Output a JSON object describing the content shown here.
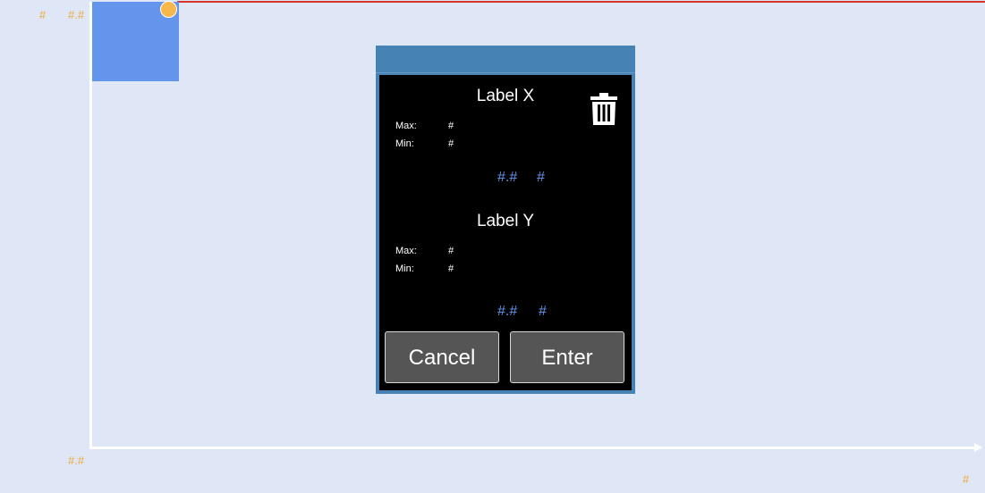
{
  "plot": {
    "top_left_label": "#",
    "y_max_label": "#.#",
    "y_min_label": "#.#",
    "x_max_label": "#"
  },
  "dialog": {
    "x_section": {
      "title": "Label X",
      "max_label": "Max:",
      "max_value": "#",
      "min_label": "Min:",
      "min_value": "#",
      "value": "#.#",
      "unit": "#"
    },
    "y_section": {
      "title": "Label Y",
      "max_label": "Max:",
      "max_value": "#",
      "min_label": "Min:",
      "min_value": "#",
      "value": "#.#",
      "unit": "#"
    },
    "delete_icon": "trash-icon",
    "cancel_label": "Cancel",
    "enter_label": "Enter"
  },
  "colors": {
    "background": "#dfe7f7",
    "region_fill": "#6495ed",
    "handle": "#f7b74a",
    "axis_label": "#f0a93b",
    "limit_line": "#d9322f",
    "dialog_frame": "#4682b4",
    "readout": "#6495ed"
  }
}
